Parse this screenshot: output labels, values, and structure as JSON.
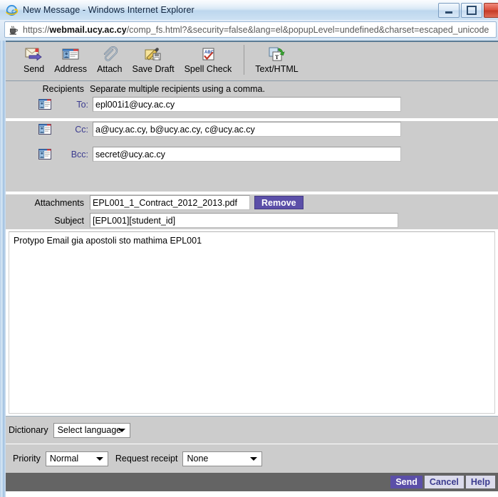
{
  "window": {
    "title": "New Message - Windows Internet Explorer",
    "app_icon": "internet-explorer-icon",
    "controls": {
      "minimize": "minimize-icon",
      "maximize": "maximize-icon",
      "close": "close-icon"
    }
  },
  "address_bar": {
    "icon": "java-coffee-icon",
    "url_prefix": "https://",
    "url_domain": "webmail.ucy.ac.cy",
    "url_suffix": "/comp_fs.html?&security=false&lang=el&popupLevel=undefined&charset=escaped_unicode",
    "url_full": "https://webmail.ucy.ac.cy/comp_fs.html?&security=false&lang=el&popupLevel=undefined&charset=escaped_unicode"
  },
  "toolbar": {
    "items": [
      {
        "label": "Send",
        "icon": "send-envelope-arrow-icon"
      },
      {
        "label": "Address",
        "icon": "address-book-card-icon"
      },
      {
        "label": "Attach",
        "icon": "paperclip-icon"
      },
      {
        "label": "Save Draft",
        "icon": "pencil-floppy-disk-icon"
      },
      {
        "label": "Spell Check",
        "icon": "abc-checkmark-icon"
      },
      {
        "label": "Text/HTML",
        "icon": "text-html-toggle-icon"
      }
    ],
    "separator_before_index": 5
  },
  "form": {
    "recipients_label": "Recipients",
    "recipients_hint": "Separate multiple recipients using a comma.",
    "to_label": "To:",
    "to_value": "epl001i1@ucy.ac.cy",
    "cc_label": "Cc:",
    "cc_value": "a@ucy.ac.cy, b@ucy.ac.cy, c@ucy.ac.cy",
    "bcc_label": "Bcc:",
    "bcc_value": "secret@ucy.ac.cy",
    "attachments_label": "Attachments",
    "attachment_value": "EPL001_1_Contract_2012_2013.pdf",
    "remove_label": "Remove",
    "subject_label": "Subject",
    "subject_value": "[EPL001][student_id]",
    "address_book_icon": "address-book-icon"
  },
  "body": {
    "text": "Protypo Email gia apostoli sto mathima EPL001"
  },
  "dictionary": {
    "label": "Dictionary",
    "selected": "Select language"
  },
  "priority": {
    "label": "Priority",
    "selected": "Normal"
  },
  "request_receipt": {
    "label": "Request receipt",
    "selected": "None"
  },
  "actions": {
    "send_label": "Send",
    "cancel_label": "Cancel",
    "help_label": "Help"
  },
  "colors": {
    "accent_purple": "#5b4fa8",
    "label_purple": "#3b3b8f",
    "form_gray": "#cccccc",
    "action_bar_gray": "#646464",
    "chrome_blue": "#cfe1f3"
  }
}
